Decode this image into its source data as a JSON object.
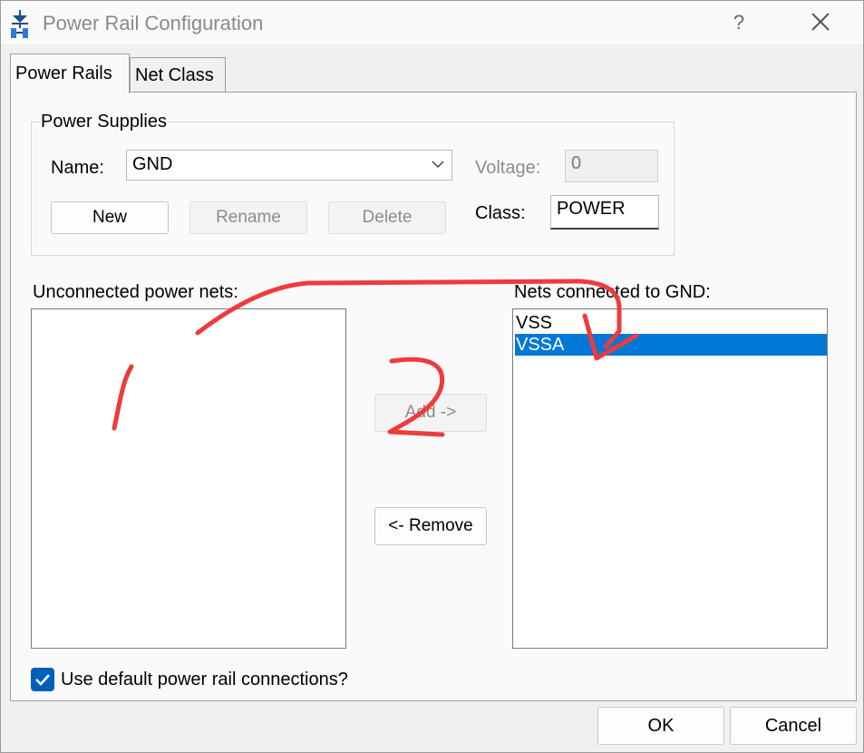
{
  "window": {
    "title": "Power Rail Configuration",
    "help_label": "?"
  },
  "tabs": [
    {
      "label": "Power Rails",
      "active": true
    },
    {
      "label": "Net Class",
      "active": false
    }
  ],
  "power_supplies": {
    "group_label": "Power Supplies",
    "name_label": "Name:",
    "name_value": "GND",
    "voltage_label": "Voltage:",
    "voltage_value": "0",
    "class_label": "Class:",
    "class_value": "POWER",
    "new_label": "New",
    "rename_label": "Rename",
    "delete_label": "Delete"
  },
  "unconnected": {
    "label": "Unconnected power nets:",
    "items": []
  },
  "connected": {
    "label": "Nets connected to GND:",
    "items": [
      {
        "label": "VSS",
        "selected": false
      },
      {
        "label": "VSSA",
        "selected": true
      }
    ]
  },
  "transfer": {
    "add_label": "Add ->",
    "remove_label": "<- Remove"
  },
  "options": {
    "use_default_label": "Use default power rail connections?",
    "use_default_checked": true
  },
  "footer": {
    "ok_label": "OK",
    "cancel_label": "Cancel"
  },
  "annotation": {
    "color": "#ef3b3b",
    "marks": [
      "1",
      "2"
    ]
  },
  "colors": {
    "selection": "#0078d7",
    "checkbox": "#005fb8"
  }
}
